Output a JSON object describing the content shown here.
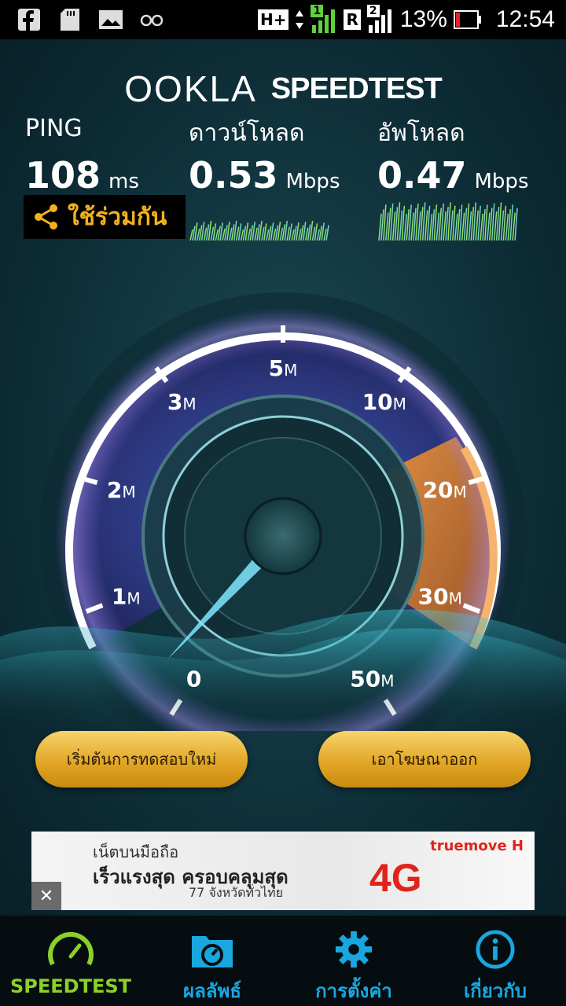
{
  "status_bar": {
    "network_type": "H+",
    "sim1_signal": "1",
    "roaming": "R",
    "sim2_signal": "2",
    "battery": "13%",
    "time": "12:54",
    "icons": [
      "facebook-icon",
      "sd-card-icon",
      "image-icon",
      "glasses-icon"
    ]
  },
  "header": {
    "logo_ookla": "OOKLA",
    "logo_speedtest": "SPEEDTEST"
  },
  "stats": {
    "ping": {
      "label": "PING",
      "value": "108",
      "unit": "ms"
    },
    "download": {
      "label": "ดาวน์โหลด",
      "value": "0.53",
      "unit": "Mbps"
    },
    "upload": {
      "label": "อัพโหลด",
      "value": "0.47",
      "unit": "Mbps"
    }
  },
  "share": {
    "label": "ใช้ร่วมกัน"
  },
  "gauge": {
    "ticks": [
      {
        "label": "0",
        "unit": ""
      },
      {
        "label": "1",
        "unit": "M"
      },
      {
        "label": "2",
        "unit": "M"
      },
      {
        "label": "3",
        "unit": "M"
      },
      {
        "label": "5",
        "unit": "M"
      },
      {
        "label": "10",
        "unit": "M"
      },
      {
        "label": "20",
        "unit": "M"
      },
      {
        "label": "30",
        "unit": "M"
      },
      {
        "label": "50",
        "unit": "M"
      }
    ],
    "needle_value_mbps": 0.3,
    "colors": {
      "ring": "#ffffff",
      "inner_dial": "#2c3f8a",
      "high_range": "#e8822e",
      "needle": "#7fe6ff"
    }
  },
  "buttons": {
    "restart_test": "เริ่มต้นการทดสอบใหม่",
    "remove_ads": "เอาโฆษณาออก"
  },
  "ad": {
    "line1": "เน็ตบนมือถือ",
    "line2": "เร็วแรงสุด ครอบคลุมสุด",
    "line3": "77 จังหวัดทั่วไทย",
    "badge": "4G",
    "brand": "truemove H",
    "close": "✕"
  },
  "bottom_nav": [
    {
      "label": "SPEEDTEST",
      "icon": "speedometer-icon",
      "active": true
    },
    {
      "label": "ผลลัพธ์",
      "icon": "folder-gauge-icon",
      "active": false
    },
    {
      "label": "การตั้งค่า",
      "icon": "gear-icon",
      "active": false
    },
    {
      "label": "เกี่ยวกับ",
      "icon": "info-icon",
      "active": false
    }
  ]
}
